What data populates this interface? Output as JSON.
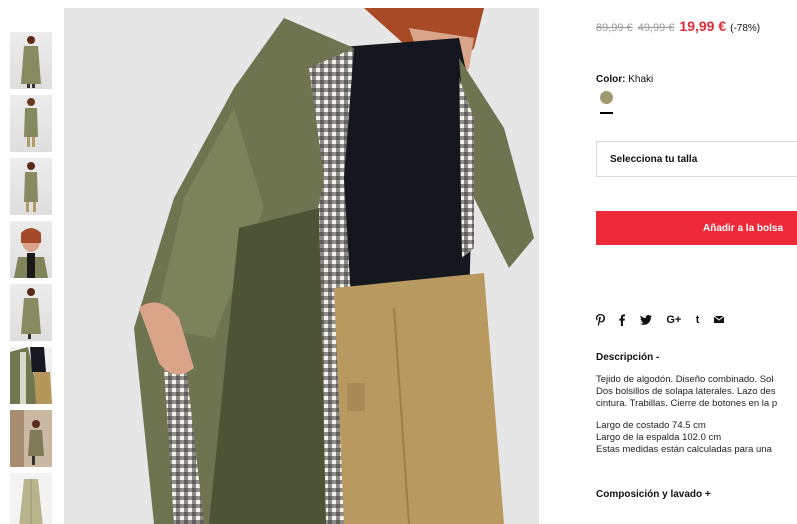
{
  "pricing": {
    "original_price": "89,99 €",
    "previous_price": "49,99 €",
    "sale_price": "19,99 €",
    "discount": "(-78%)"
  },
  "color": {
    "label": "Color:",
    "value": "Khaki",
    "swatch_color": "#a09a72"
  },
  "size_select": {
    "placeholder": "Selecciona tu talla"
  },
  "add_to_bag": {
    "label": "Añadir a la bolsa",
    "color": "#ee2939"
  },
  "share_icons": [
    "pinterest-icon",
    "facebook-icon",
    "twitter-icon",
    "google-plus-icon",
    "tumblr-icon",
    "email-icon"
  ],
  "description": {
    "title": "Descripción -",
    "lines": [
      "Tejido de algodón. Diseño combinado. Sol",
      "Dos bolsillos de solapa laterales. Lazo des",
      "cintura. Trabillas. Cierre de botones en la p"
    ],
    "measures": [
      "Largo de costado 74.5 cm",
      "Largo de la espalda 102.0 cm",
      "Estas medidas están calculadas para una"
    ]
  },
  "composition": {
    "title": "Composición y lavado +"
  },
  "thumbnails": [
    "thumb-front",
    "thumb-front-open",
    "thumb-back",
    "thumb-detail-face",
    "thumb-side",
    "thumb-detail-lining",
    "thumb-outdoor",
    "thumb-flat"
  ]
}
